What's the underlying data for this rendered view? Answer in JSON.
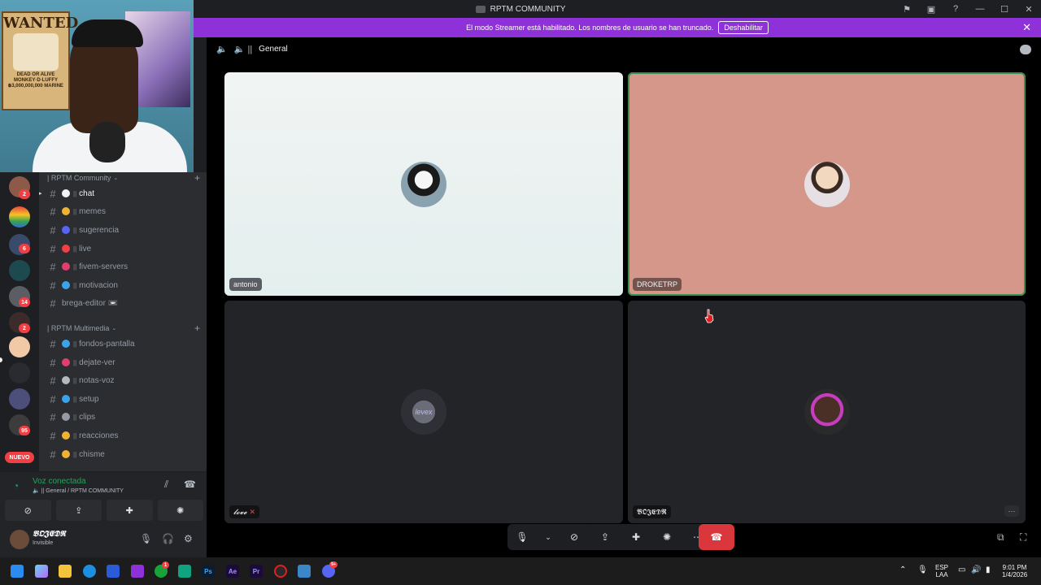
{
  "titlebar": {
    "title": "RPTM COMMUNITY"
  },
  "banner": {
    "text": "El modo Streamer está habilitado. Los nombres de usuario se han truncado.",
    "button": "Deshabilitar",
    "close": "✕"
  },
  "webcam": {
    "poster_title": "WANTED",
    "poster_text": "DEAD OR ALIVE MONKEY·D·LUFFY ฿3,000,000,000 MARINE"
  },
  "rail": {
    "badges": [
      "2",
      "6",
      "14",
      "2",
      "95"
    ],
    "new_label": "NUEVO"
  },
  "categories": [
    {
      "label": "| RPTM Community"
    },
    {
      "label": "| RPTM Multimedia"
    }
  ],
  "channels": [
    {
      "name": "chat",
      "emoji_color": "#f2f3f5"
    },
    {
      "name": "memes",
      "emoji_color": "#f0b232"
    },
    {
      "name": "sugerencia",
      "emoji_color": "#5865f2"
    },
    {
      "name": "live",
      "emoji_color": "#f23f43"
    },
    {
      "name": "fivem-servers",
      "emoji_color": "#e03e6f"
    },
    {
      "name": "motivacion",
      "emoji_color": "#3ba3e8"
    },
    {
      "name": "brega-editor 📼",
      "emoji_color": ""
    },
    {
      "name": "fondos-pantalla",
      "emoji_color": "#3ba3e8"
    },
    {
      "name": "dejate-ver",
      "emoji_color": "#e03e6f"
    },
    {
      "name": "notas-voz",
      "emoji_color": "#b5bac1"
    },
    {
      "name": "setup",
      "emoji_color": "#3ba3e8"
    },
    {
      "name": "clips",
      "emoji_color": "#949ba4"
    },
    {
      "name": "reacciones",
      "emoji_color": "#f0b232"
    },
    {
      "name": "chisme",
      "emoji_color": "#f0b232"
    }
  ],
  "voice": {
    "status": "Voz conectada",
    "location": "General / RPTM COMMUNITY"
  },
  "user": {
    "name": "𝕭𝕺𝕵𝕰𝕯𝕽",
    "status": "Invisible"
  },
  "main": {
    "channel": "General"
  },
  "tiles": [
    {
      "name": "antonio",
      "bg": "#e7f0ef"
    },
    {
      "name": "DROKETRP",
      "bg": "#d4978a"
    },
    {
      "name": "𝓵𝓸𝓿𝓮",
      "bg": "#232428"
    },
    {
      "name": "𝕭𝕺𝕵𝕰𝕯𝕽",
      "bg": "#232428"
    }
  ],
  "tile3_badge": "✕",
  "tile4_more": "···",
  "avatar3_label": "levex",
  "taskbar": {
    "apps": [
      "Ps",
      "Ae",
      "Pr"
    ],
    "discord_badge": "9+",
    "xbox_badge": "1",
    "lang": "ESP",
    "lang2": "LAA",
    "time": "9:01 PM",
    "date": "1/4/2026"
  }
}
